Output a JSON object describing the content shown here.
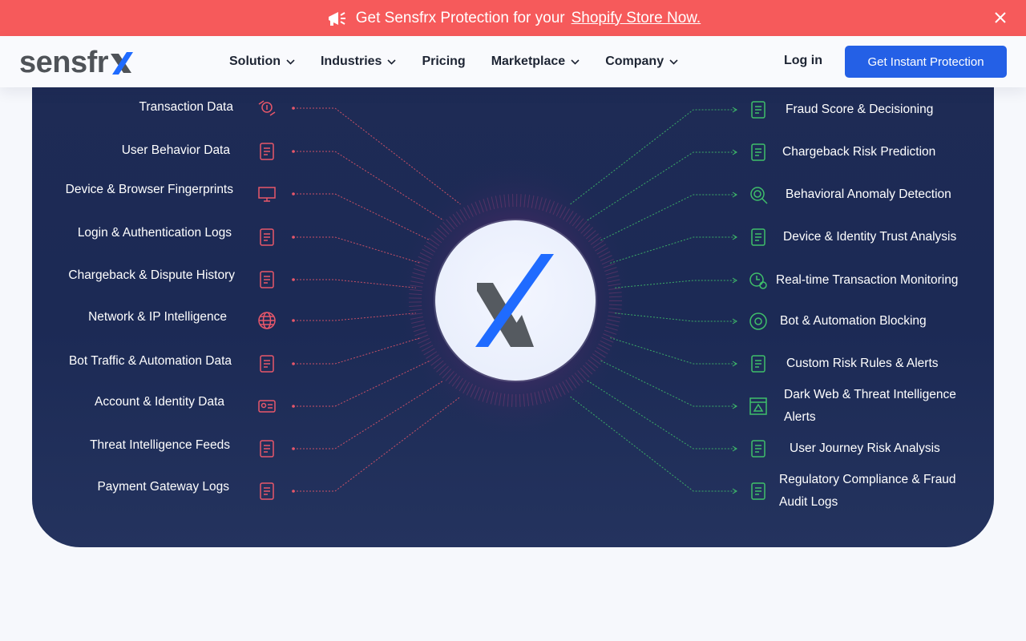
{
  "promo": {
    "text": "Get Sensfrx Protection for your",
    "link": "Shopify Store Now.",
    "icon": "megaphone-icon",
    "close_icon": "close-icon",
    "bg_color": "#f65a5b"
  },
  "nav": {
    "logo_text": "sensfr",
    "menu": [
      {
        "label": "Solution",
        "dropdown": true
      },
      {
        "label": "Industries",
        "dropdown": true
      },
      {
        "label": "Pricing",
        "dropdown": false
      },
      {
        "label": "Marketplace",
        "dropdown": true
      },
      {
        "label": "Company",
        "dropdown": true
      }
    ],
    "login": "Log in",
    "cta": "Get Instant Protection",
    "cta_color": "#2460e6"
  },
  "diagram": {
    "inputs": [
      {
        "label": "Transaction Data",
        "icon": "dollar-exchange-icon"
      },
      {
        "label": "User Behavior Data",
        "icon": "user-profile-icon"
      },
      {
        "label": "Device & Browser Fingerprints",
        "icon": "monitor-icon"
      },
      {
        "label": "Login & Authentication Logs",
        "icon": "shield-user-icon"
      },
      {
        "label": "Chargeback & Dispute History",
        "icon": "clipboard-clock-icon"
      },
      {
        "label": "Network & IP Intelligence",
        "icon": "globe-icon"
      },
      {
        "label": "Bot Traffic & Automation Data",
        "icon": "bot-gear-icon"
      },
      {
        "label": "Account & Identity Data",
        "icon": "id-card-icon"
      },
      {
        "label": "Threat Intelligence Feeds",
        "icon": "lock-document-icon"
      },
      {
        "label": "Payment Gateway Logs",
        "icon": "document-log-icon"
      }
    ],
    "outputs": [
      {
        "label": "Fraud Score & Decisioning",
        "icon": "decision-tree-icon"
      },
      {
        "label": "Chargeback Risk Prediction",
        "icon": "trend-hand-icon"
      },
      {
        "label": "Behavioral Anomaly Detection",
        "icon": "target-search-icon"
      },
      {
        "label": "Device & Identity Trust Analysis",
        "icon": "megaphone-chart-icon"
      },
      {
        "label": "Real-time Transaction Monitoring",
        "icon": "clock-dollar-icon"
      },
      {
        "label": "Bot & Automation Blocking",
        "icon": "gear-block-icon"
      },
      {
        "label": "Custom Risk Rules & Alerts",
        "icon": "rules-list-icon"
      },
      {
        "label": "Dark Web & Threat Intelligence Alerts",
        "icon": "warning-window-icon"
      },
      {
        "label": "User Journey Risk Analysis",
        "icon": "journey-path-icon"
      },
      {
        "label": "Regulatory Compliance & Fraud Audit Logs",
        "icon": "audit-search-icon"
      }
    ],
    "input_color": "#e8576a",
    "output_color": "#3fbf6a",
    "core_logo": "sensfrx-x-logo"
  }
}
